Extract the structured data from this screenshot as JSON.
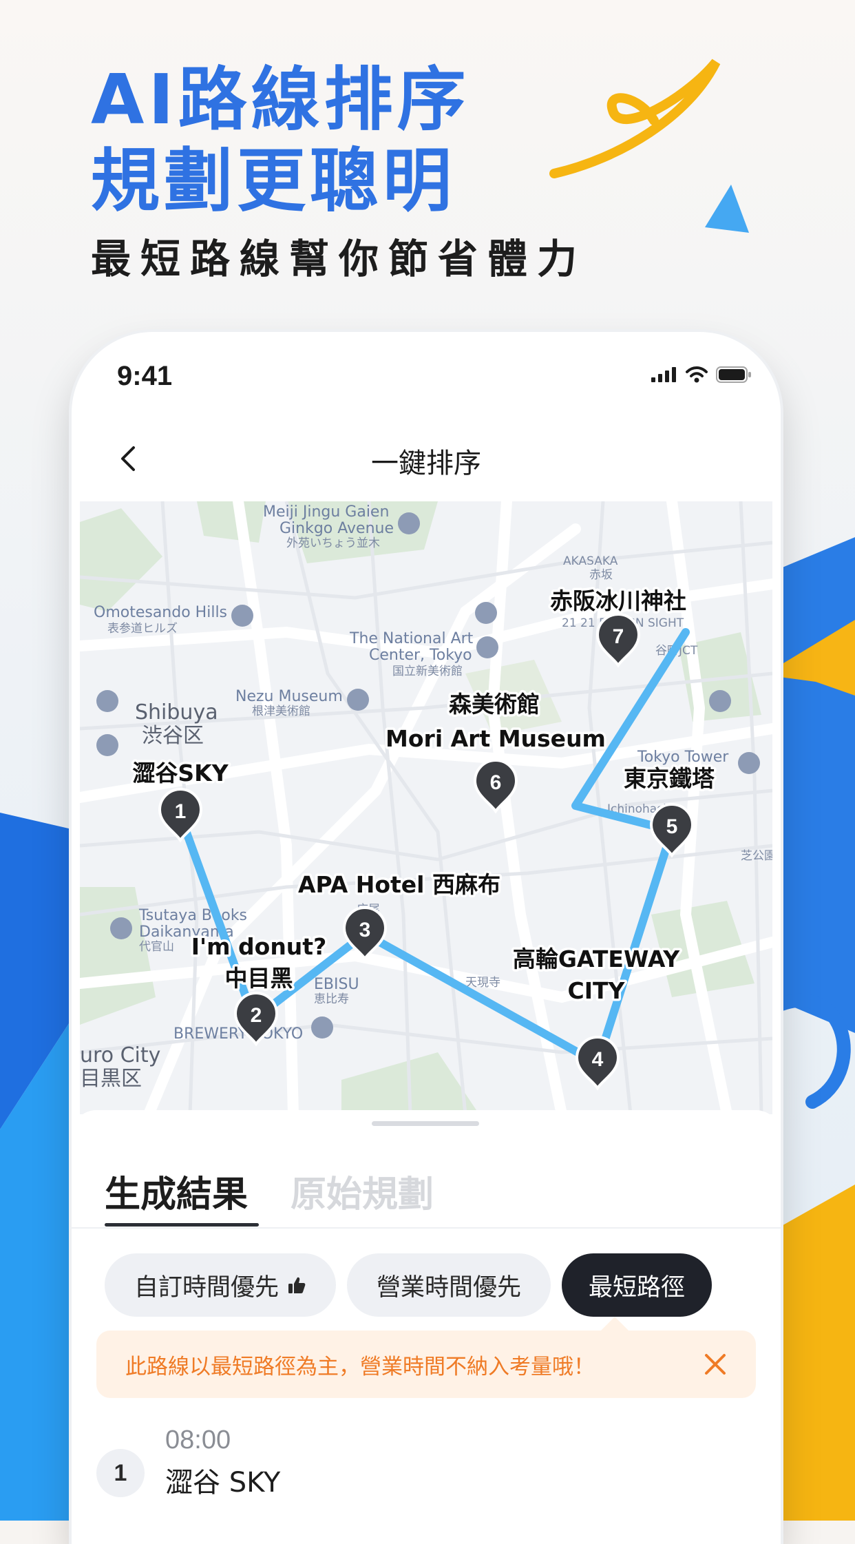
{
  "headline": {
    "line1": "AI路線排序",
    "line2": "規劃更聰明"
  },
  "subhead": "最短路線幫你節省體力",
  "status_bar": {
    "time": "9:41"
  },
  "nav": {
    "title": "一鍵排序"
  },
  "map": {
    "labels": {
      "meiji": "Meiji Jingu Gaien",
      "meiji2": "Ginkgo Avenue",
      "meiji3": "外苑いちょう並木",
      "akasaka": "AKASAKA",
      "akasaka2": "赤坂",
      "design": "21 21 DESIGN SIGHT",
      "omotesando": "Omotesando Hills",
      "omotesando2": "表参道ヒルズ",
      "nac": "The National Art",
      "nac2": "Center, Tokyo",
      "nac3": "国立新美術館",
      "nezu": "Nezu Museum",
      "nezu2": "根津美術館",
      "shibuya": "Shibuya",
      "shibuya2": "渋谷区",
      "tokyo_tower": "Tokyo Tower",
      "tsutaya": "Tsutaya Books",
      "tsutaya2": "Daikanyama",
      "tsutaya3": "代官山",
      "ebisu": "EBISU",
      "ebisu2": "恵比寿",
      "brewery": "BREWERY TOKYO",
      "meguro": "uro City",
      "meguro2": "目黒区",
      "hiroo": "広尾",
      "tengenji": "天現寺",
      "junction": "谷町JCT",
      "ichinohashi": "Ichinohashi",
      "shibakoen": "芝公園"
    },
    "stops": [
      {
        "num": "1",
        "name": "澀谷SKY"
      },
      {
        "num": "2",
        "name_line1": "I'm donut?",
        "name_line2": "中目黑"
      },
      {
        "num": "3",
        "name": "APA Hotel 西麻布"
      },
      {
        "num": "4",
        "name_line1": "高輪GATEWAY",
        "name_line2": "CITY"
      },
      {
        "num": "5",
        "name": "東京鐵塔"
      },
      {
        "num": "6",
        "name_line1": "森美術館",
        "name_line2": "Mori Art Museum"
      },
      {
        "num": "7",
        "name": "赤阪冰川神社"
      }
    ]
  },
  "tabs": {
    "active": "生成結果",
    "inactive": "原始規劃"
  },
  "chips": [
    {
      "label": "自訂時間優先"
    },
    {
      "label": "營業時間優先"
    },
    {
      "label": "最短路徑"
    }
  ],
  "notice": "此路線以最短路徑為主，營業時間不納入考量哦！",
  "first_item": {
    "num": "1",
    "time": "08:00",
    "name": "澀谷 SKY"
  },
  "colors": {
    "accent": "#2f72e2",
    "route": "#56b7f3",
    "notice": "#ef7b26",
    "pin": "#3b3d42"
  }
}
